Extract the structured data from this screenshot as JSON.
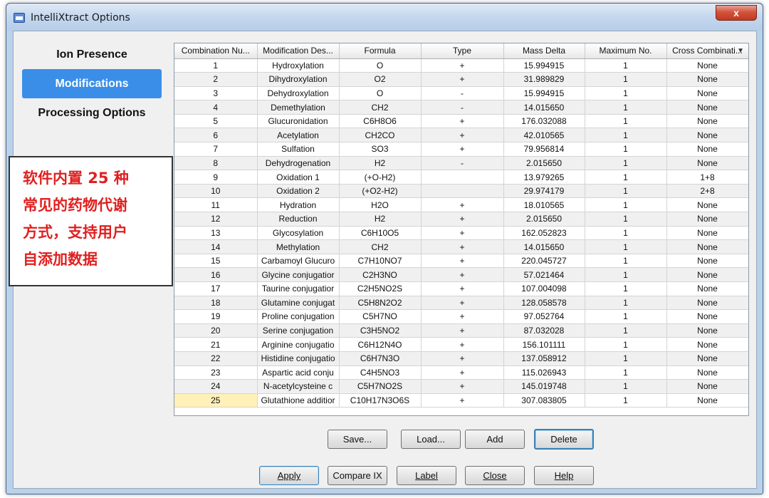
{
  "window": {
    "title": "IntelliXtract Options",
    "close_label": "x"
  },
  "nav": {
    "items": [
      {
        "label": "Ion Presence",
        "active": false
      },
      {
        "label": "Modifications",
        "active": true
      },
      {
        "label": "Processing Options",
        "active": false
      }
    ]
  },
  "callout": {
    "lines": [
      "软件内置 25 种",
      "常见的药物代谢",
      "方式，支持用户",
      "自添加数据"
    ]
  },
  "table": {
    "columns": [
      "Combination Nu...",
      "Modification Des...",
      "Formula",
      "Type",
      "Mass Delta",
      "Maximum No.",
      "Cross Combinati..."
    ],
    "rows": [
      [
        "1",
        "Hydroxylation",
        "O",
        "+",
        "15.994915",
        "1",
        "None"
      ],
      [
        "2",
        "Dihydroxylation",
        "O2",
        "+",
        "31.989829",
        "1",
        "None"
      ],
      [
        "3",
        "Dehydroxylation",
        "O",
        "-",
        "15.994915",
        "1",
        "None"
      ],
      [
        "4",
        "Demethylation",
        "CH2",
        "-",
        "14.015650",
        "1",
        "None"
      ],
      [
        "5",
        "Glucuronidation",
        "C6H8O6",
        "+",
        "176.032088",
        "1",
        "None"
      ],
      [
        "6",
        "Acetylation",
        "CH2CO",
        "+",
        "42.010565",
        "1",
        "None"
      ],
      [
        "7",
        "Sulfation",
        "SO3",
        "+",
        "79.956814",
        "1",
        "None"
      ],
      [
        "8",
        "Dehydrogenation",
        "H2",
        "-",
        "2.015650",
        "1",
        "None"
      ],
      [
        "9",
        "Oxidation 1",
        "(+O-H2)",
        "",
        "13.979265",
        "1",
        "1+8"
      ],
      [
        "10",
        "Oxidation 2",
        "(+O2-H2)",
        "",
        "29.974179",
        "1",
        "2+8"
      ],
      [
        "11",
        "Hydration",
        "H2O",
        "+",
        "18.010565",
        "1",
        "None"
      ],
      [
        "12",
        "Reduction",
        "H2",
        "+",
        "2.015650",
        "1",
        "None"
      ],
      [
        "13",
        "Glycosylation",
        "C6H10O5",
        "+",
        "162.052823",
        "1",
        "None"
      ],
      [
        "14",
        "Methylation",
        "CH2",
        "+",
        "14.015650",
        "1",
        "None"
      ],
      [
        "15",
        "Carbamoyl Glucuro",
        "C7H10NO7",
        "+",
        "220.045727",
        "1",
        "None"
      ],
      [
        "16",
        "Glycine conjugatior",
        "C2H3NO",
        "+",
        "57.021464",
        "1",
        "None"
      ],
      [
        "17",
        "Taurine conjugatior",
        "C2H5NO2S",
        "+",
        "107.004098",
        "1",
        "None"
      ],
      [
        "18",
        "Glutamine conjugat",
        "C5H8N2O2",
        "+",
        "128.058578",
        "1",
        "None"
      ],
      [
        "19",
        "Proline conjugation",
        "C5H7NO",
        "+",
        "97.052764",
        "1",
        "None"
      ],
      [
        "20",
        "Serine conjugation",
        "C3H5NO2",
        "+",
        "87.032028",
        "1",
        "None"
      ],
      [
        "21",
        "Arginine conjugatio",
        "C6H12N4O",
        "+",
        "156.101111",
        "1",
        "None"
      ],
      [
        "22",
        "Histidine conjugatio",
        "C6H7N3O",
        "+",
        "137.058912",
        "1",
        "None"
      ],
      [
        "23",
        "Aspartic acid conju",
        "C4H5NO3",
        "+",
        "115.026943",
        "1",
        "None"
      ],
      [
        "24",
        "N-acetylcysteine c",
        "C5H7NO2S",
        "+",
        "145.019748",
        "1",
        "None"
      ],
      [
        "25",
        "Glutathione additior",
        "C10H17N3O6S",
        "+",
        "307.083805",
        "1",
        "None"
      ]
    ]
  },
  "buttons": {
    "save": "Save...",
    "load": "Load...",
    "add": "Add",
    "delete": "Delete",
    "apply": "Apply",
    "compare": "Compare IX",
    "label": "Label",
    "close": "Close",
    "help": "Help"
  },
  "colors": {
    "nav_active": "#3b8ee8",
    "callout_text": "#e02020",
    "selected_cell": "#fff1b8"
  }
}
